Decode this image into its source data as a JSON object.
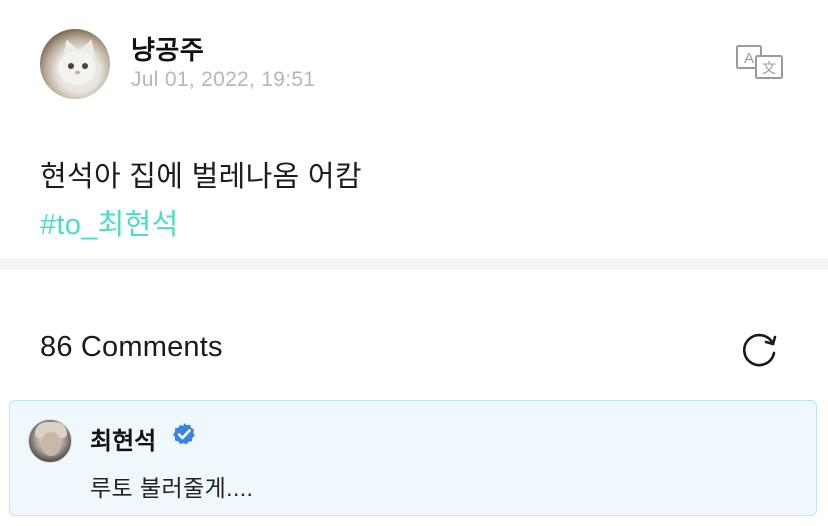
{
  "post": {
    "author": "냥공주",
    "date": "Jul 01, 2022, 19:51",
    "text": "현석아 집에 벌레나옴 어캄",
    "hashtag": "#to_최현석"
  },
  "comments": {
    "title": "86 Comments",
    "items": [
      {
        "author": "최현석",
        "verified": true,
        "text": "루토 불러줄게...."
      }
    ]
  },
  "icons": {
    "translate": "translate-icon",
    "refresh": "refresh-icon",
    "verified": "verified-badge-icon"
  },
  "colors": {
    "hashtag": "#4fdcc4",
    "verified": "#3b82e6",
    "comment_highlight_bg": "#eff8fd",
    "comment_highlight_border": "#bfe3f4",
    "date": "#b7b7b7"
  }
}
